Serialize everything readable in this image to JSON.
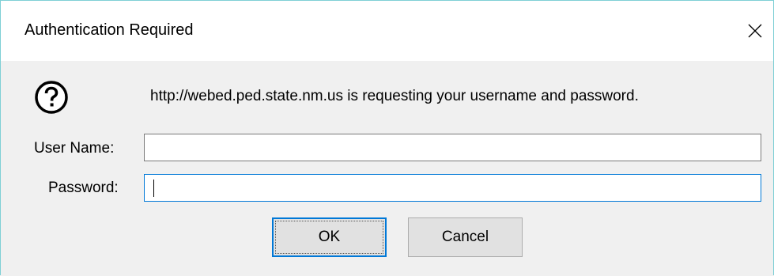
{
  "window": {
    "title": "Authentication Required",
    "close_icon": "close-icon"
  },
  "prompt": {
    "icon": "question-icon",
    "message": "http://webed.ped.state.nm.us is requesting your username and password."
  },
  "form": {
    "username_label": "User Name:",
    "username_value": "",
    "password_label": "Password:",
    "password_value": ""
  },
  "buttons": {
    "ok_label": "OK",
    "cancel_label": "Cancel"
  },
  "colors": {
    "focus_border": "#0078d7",
    "dialog_bg": "#f0f0f0",
    "titlebar_bg": "#ffffff",
    "window_border": "#7fd0d6"
  }
}
